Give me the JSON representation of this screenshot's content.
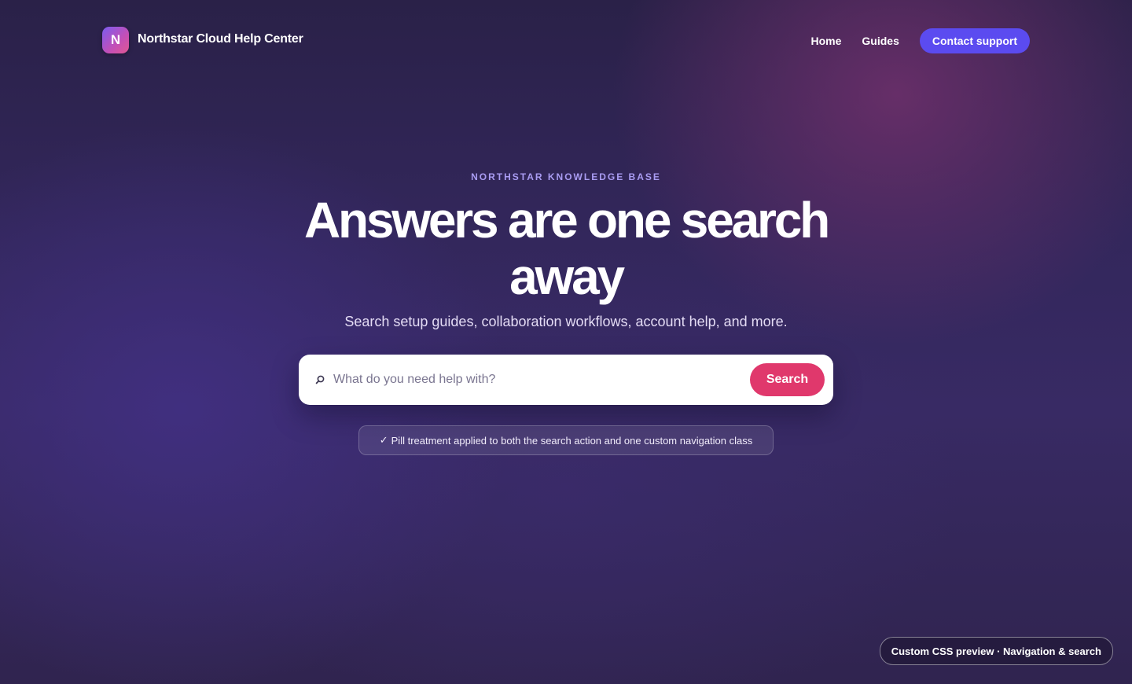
{
  "brand": {
    "logo_letter": "N",
    "name": "Northstar Cloud Help Center"
  },
  "nav": {
    "items": [
      {
        "label": "Home"
      },
      {
        "label": "Guides"
      }
    ],
    "cta_label": "Contact support"
  },
  "hero": {
    "eyebrow": "NORTHSTAR KNOWLEDGE BASE",
    "headline": "Answers are one search away",
    "subhead": "Search setup guides, collaboration workflows, account help, and more."
  },
  "search": {
    "icon": "search-icon",
    "placeholder": "What do you need help with?",
    "value": "",
    "button_label": "Search"
  },
  "note": {
    "check": "✓",
    "text": "Pill treatment applied to both the search action and one custom navigation class"
  },
  "badge": {
    "label": "Custom CSS preview · Navigation & search"
  },
  "colors": {
    "accent_nav": "#5b4bf0",
    "accent_search": "#e0386c",
    "eyebrow": "#a99cf2"
  }
}
